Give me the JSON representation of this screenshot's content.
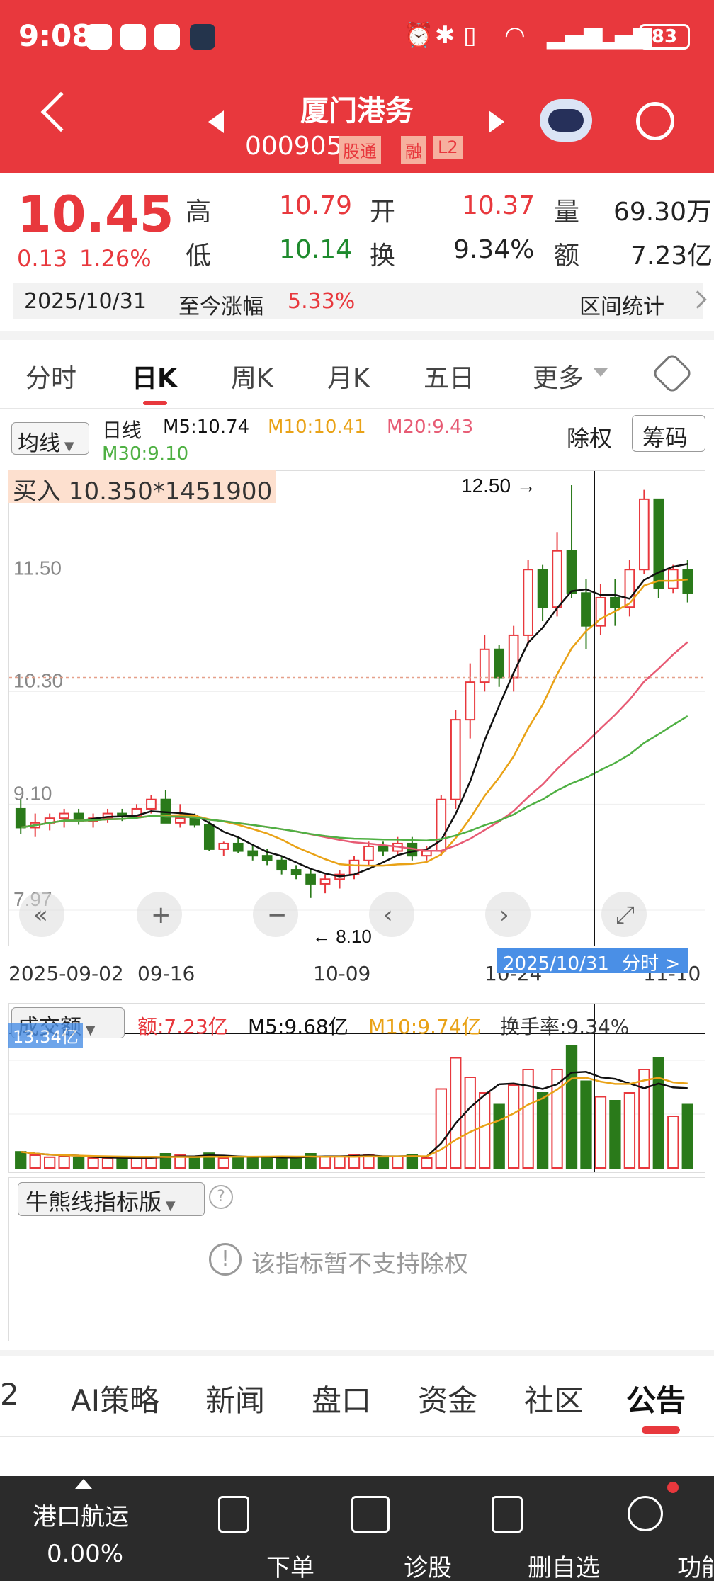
{
  "status_bar": {
    "time": "9:08",
    "battery": "83"
  },
  "header": {
    "title": "厦门港务",
    "code": "000905",
    "badges": [
      "股通",
      "融",
      "L2"
    ]
  },
  "quote": {
    "price": "10.45",
    "change": "0.13",
    "change_pct": "1.26%",
    "high_label": "高",
    "high": "10.79",
    "open_label": "开",
    "open": "10.37",
    "volume_label": "量",
    "volume": "69.30万",
    "low_label": "低",
    "low": "10.14",
    "turnover_label": "换",
    "turnover": "9.34%",
    "amount_label": "额",
    "amount": "7.23亿",
    "date": "2025/10/31",
    "since_label": "至今涨幅",
    "since_value": "5.33%",
    "range_stats": "区间统计"
  },
  "tabs": [
    "分时",
    "日K",
    "周K",
    "月K",
    "五日",
    "更多"
  ],
  "active_tab": "日K",
  "chart_bar": {
    "ma_select": "均线",
    "line_label": "日线",
    "m5": "M5:10.74",
    "m10": "M10:10.41",
    "m20": "M20:9.43",
    "m30": "M30:9.10",
    "adjust": "除权",
    "chips": "筹码"
  },
  "chart_overlay": {
    "buy_label": "买入 10.350*1451900",
    "high_mark": "12.50",
    "low_mark": "8.10",
    "y_ticks": [
      "11.50",
      "10.30",
      "9.10",
      "7.97"
    ],
    "x_ticks": [
      "2025-09-02",
      "09-16",
      "10-09",
      "10-24",
      "11-10"
    ],
    "cursor_date": "2025/10/31",
    "cursor_link": "分时 >"
  },
  "chart_data": {
    "type": "candlestick",
    "ylim": [
      7.97,
      12.5
    ],
    "ohlc": [
      [
        9.05,
        9.15,
        8.78,
        8.85
      ],
      [
        8.85,
        9.0,
        8.75,
        8.9
      ],
      [
        8.9,
        9.0,
        8.82,
        8.95
      ],
      [
        8.95,
        9.05,
        8.85,
        9.0
      ],
      [
        9.0,
        9.05,
        8.88,
        8.92
      ],
      [
        8.92,
        9.0,
        8.85,
        8.95
      ],
      [
        8.95,
        9.05,
        8.9,
        9.0
      ],
      [
        9.0,
        9.05,
        8.92,
        8.97
      ],
      [
        8.97,
        9.1,
        8.95,
        9.05
      ],
      [
        9.05,
        9.2,
        9.0,
        9.15
      ],
      [
        9.15,
        9.25,
        8.95,
        8.9
      ],
      [
        8.9,
        9.1,
        8.85,
        8.95
      ],
      [
        8.95,
        9.0,
        8.85,
        8.88
      ],
      [
        8.88,
        8.92,
        8.6,
        8.62
      ],
      [
        8.62,
        8.7,
        8.55,
        8.68
      ],
      [
        8.68,
        8.75,
        8.58,
        8.6
      ],
      [
        8.6,
        8.65,
        8.5,
        8.55
      ],
      [
        8.55,
        8.62,
        8.45,
        8.5
      ],
      [
        8.5,
        8.55,
        8.35,
        8.4
      ],
      [
        8.4,
        8.45,
        8.3,
        8.35
      ],
      [
        8.35,
        8.4,
        8.1,
        8.25
      ],
      [
        8.25,
        8.35,
        8.15,
        8.3
      ],
      [
        8.3,
        8.4,
        8.2,
        8.35
      ],
      [
        8.35,
        8.55,
        8.3,
        8.5
      ],
      [
        8.5,
        8.7,
        8.45,
        8.65
      ],
      [
        8.65,
        8.7,
        8.55,
        8.6
      ],
      [
        8.6,
        8.75,
        8.55,
        8.68
      ],
      [
        8.68,
        8.75,
        8.5,
        8.55
      ],
      [
        8.55,
        8.65,
        8.5,
        8.6
      ],
      [
        8.6,
        9.2,
        8.55,
        9.15
      ],
      [
        9.15,
        10.1,
        9.05,
        10.0
      ],
      [
        10.0,
        10.6,
        9.8,
        10.4
      ],
      [
        10.4,
        10.9,
        10.3,
        10.75
      ],
      [
        10.75,
        10.8,
        10.35,
        10.45
      ],
      [
        10.45,
        11.0,
        10.3,
        10.9
      ],
      [
        10.9,
        11.7,
        10.8,
        11.6
      ],
      [
        11.6,
        11.65,
        11.05,
        11.2
      ],
      [
        11.2,
        12.0,
        11.1,
        11.8
      ],
      [
        11.8,
        12.5,
        11.3,
        11.35
      ],
      [
        11.35,
        11.5,
        10.75,
        11.0
      ],
      [
        11.0,
        11.45,
        10.9,
        11.3
      ],
      [
        11.3,
        11.5,
        11.0,
        11.2
      ],
      [
        11.2,
        11.7,
        11.1,
        11.6
      ],
      [
        11.6,
        12.45,
        11.55,
        12.35
      ],
      [
        12.35,
        12.35,
        11.3,
        11.4
      ],
      [
        11.4,
        11.65,
        11.35,
        11.6
      ],
      [
        11.6,
        11.7,
        11.25,
        11.35
      ]
    ],
    "ma_series": [
      {
        "name": "M5",
        "color": "#111111",
        "last": 10.74
      },
      {
        "name": "M10",
        "color": "#e9a216",
        "last": 10.41
      },
      {
        "name": "M20",
        "color": "#e75b74",
        "last": 9.43
      },
      {
        "name": "M30",
        "color": "#4fb043",
        "last": 9.1
      }
    ],
    "volume_label": "成交额",
    "vol_amount": "额:7.23亿",
    "vol_m5": "M5:9.68亿",
    "vol_m10": "M10:9.74亿",
    "turnover_label": "换手率:9.34%",
    "vol_axis": "13.34亿"
  },
  "indicator": {
    "title": "牛熊线指标版",
    "notice": "该指标暂不支持除权"
  },
  "bottom_tabs": [
    "2",
    "AI策略",
    "新闻",
    "盘口",
    "资金",
    "社区",
    "公告"
  ],
  "active_bottom_tab": "公告",
  "bottom_bar": {
    "index_name": "港口航运",
    "index_value": "0.00%",
    "items": [
      "下单",
      "诊股",
      "删自选",
      "功能"
    ]
  }
}
